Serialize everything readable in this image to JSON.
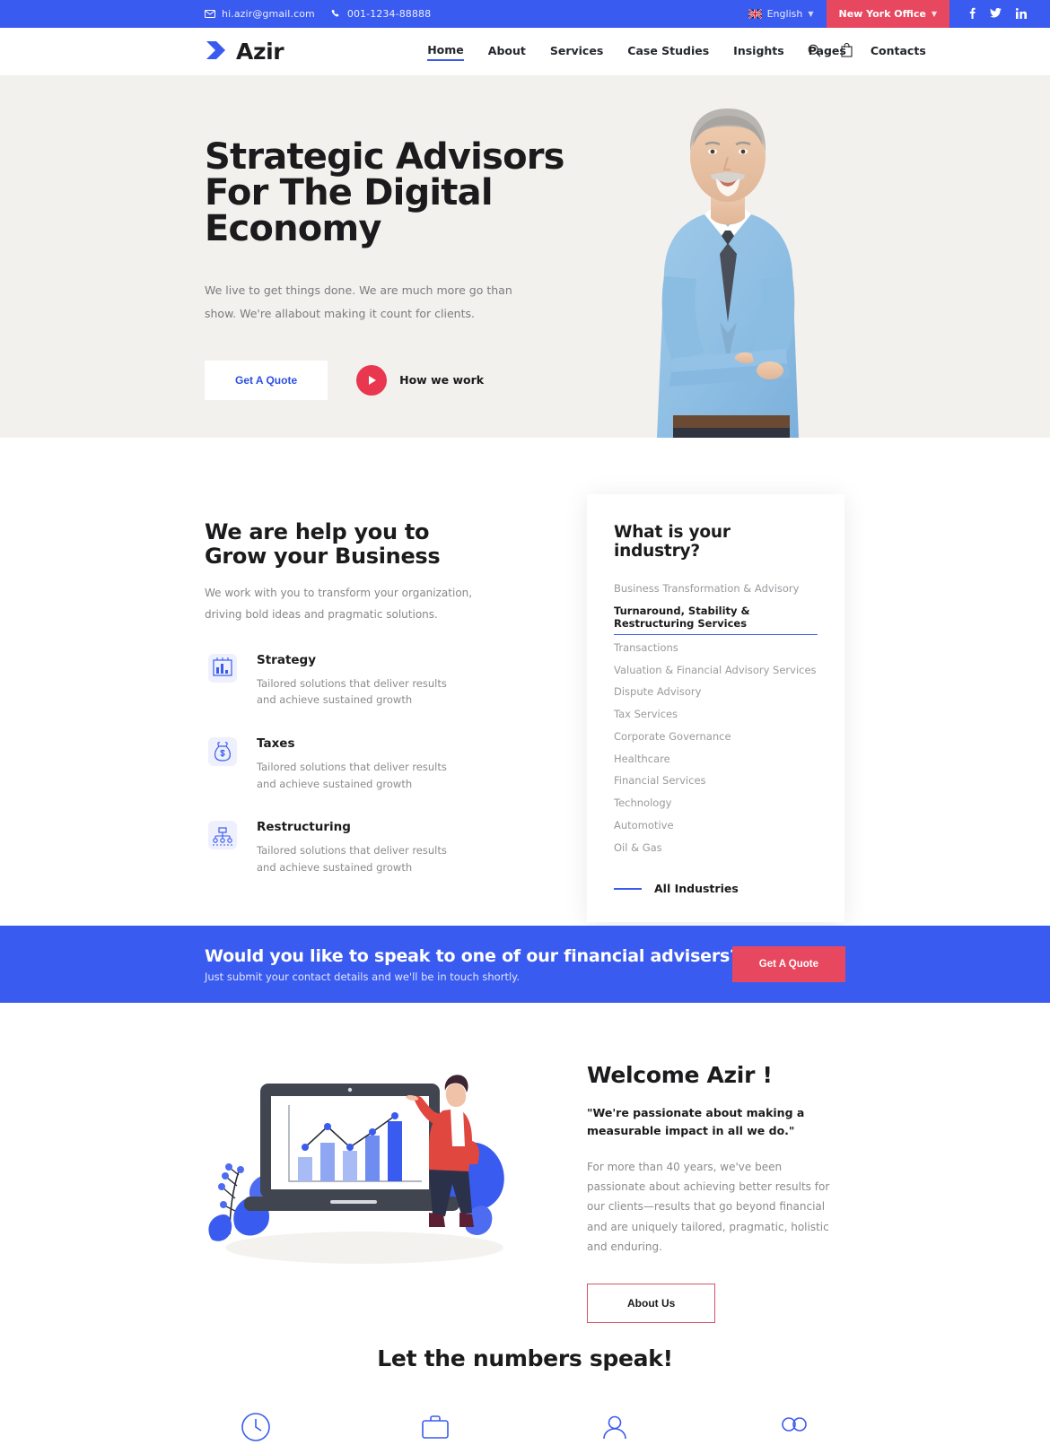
{
  "topbar": {
    "email": "hi.azir@gmail.com",
    "phone": "001-1234-88888",
    "language": "English",
    "office": "New York Office",
    "socials": [
      "f",
      "t",
      "in"
    ],
    "bg_color": "#3a5bef",
    "office_color": "#e8485f"
  },
  "header": {
    "brand": "Azir",
    "nav": [
      {
        "label": "Home",
        "active": true
      },
      {
        "label": "About",
        "active": false
      },
      {
        "label": "Services",
        "active": false
      },
      {
        "label": "Case Studies",
        "active": false
      },
      {
        "label": "Insights",
        "active": false
      },
      {
        "label": "Pages",
        "active": false
      },
      {
        "label": "Contacts",
        "active": false
      }
    ]
  },
  "hero": {
    "title_line1": "Strategic Advisors",
    "title_line2": "For The Digital",
    "title_line3": "Economy",
    "subtitle": "We live to get things done. We are much more go than show. We're allabout making it count for clients.",
    "primary_button": "Get A Quote",
    "video_label": "How we work",
    "bg_color": "#f3f1ed"
  },
  "grow": {
    "title_line1": "We are help you to",
    "title_line2": "Grow your Business",
    "subtitle": "We work with you to transform your organization, driving bold ideas and pragmatic solutions.",
    "features": [
      {
        "icon": "bar-chart-icon",
        "title": "Strategy",
        "desc": "Tailored solutions that deliver results and achieve sustained growth"
      },
      {
        "icon": "money-bag-icon",
        "title": "Taxes",
        "desc": "Tailored solutions that deliver results and achieve sustained growth"
      },
      {
        "icon": "org-chart-icon",
        "title": "Restructuring",
        "desc": "Tailored solutions that deliver results and achieve sustained growth"
      }
    ]
  },
  "industry": {
    "title": "What is your industry?",
    "items": [
      {
        "label": "Business Transformation & Advisory",
        "active": false
      },
      {
        "label": "Turnaround, Stability & Restructuring Services",
        "active": true
      },
      {
        "label": "Transactions",
        "active": false
      },
      {
        "label": "Valuation & Financial Advisory Services",
        "active": false
      },
      {
        "label": "Dispute Advisory",
        "active": false
      },
      {
        "label": "Tax Services",
        "active": false
      },
      {
        "label": "Corporate Governance",
        "active": false
      },
      {
        "label": "Healthcare",
        "active": false
      },
      {
        "label": "Financial Services",
        "active": false
      },
      {
        "label": "Technology",
        "active": false
      },
      {
        "label": "Automotive",
        "active": false
      },
      {
        "label": "Oil & Gas",
        "active": false
      }
    ],
    "all_link": "All Industries"
  },
  "cta": {
    "title": "Would you like to speak to one of our financial advisers?",
    "subtitle": "Just submit your contact details and we'll be in touch shortly.",
    "button": "Get A Quote"
  },
  "welcome": {
    "title": "Welcome Azir !",
    "quote": "\"We're passionate about making a measurable impact in all we do.\"",
    "body": "For more than 40 years, we've been passionate about achieving better results for our clients—results that go beyond financial and are uniquely tailored, pragmatic, holistic and enduring.",
    "button": "About Us"
  },
  "numbers": {
    "title": "Let the numbers speak!",
    "stats": [
      {
        "icon": "clock-icon"
      },
      {
        "icon": "briefcase-icon"
      },
      {
        "icon": "user-icon"
      },
      {
        "icon": "handshake-icon"
      }
    ]
  }
}
